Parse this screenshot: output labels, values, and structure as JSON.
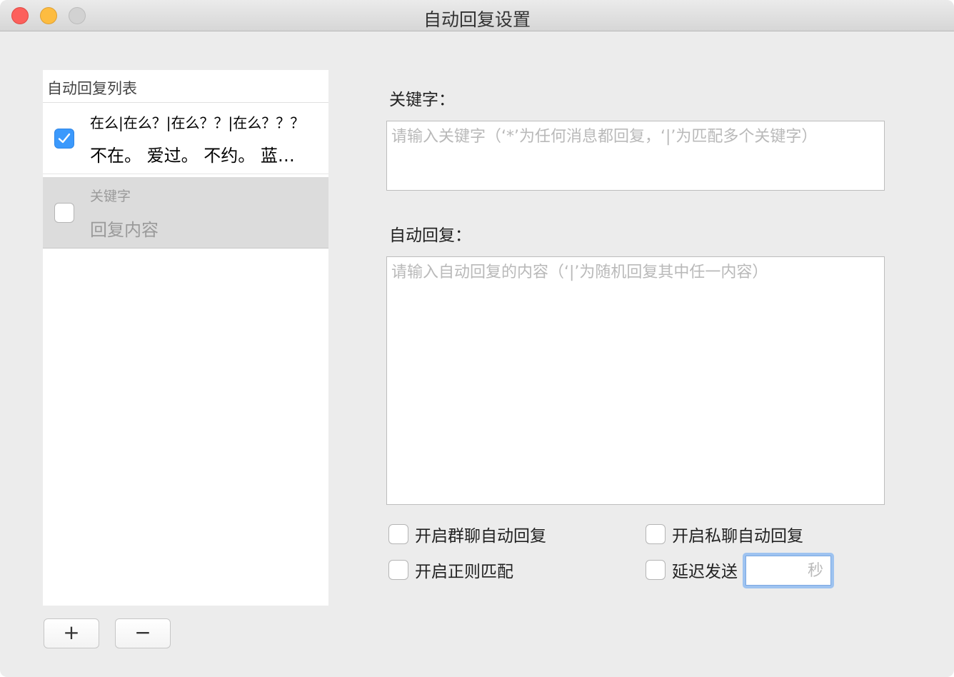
{
  "window": {
    "title": "自动回复设置"
  },
  "list": {
    "header": "自动回复列表",
    "items": [
      {
        "checked": true,
        "keyword": "在么|在么？|在么？？|在么？？？",
        "reply": "不在。 爱过。 不约。 蓝瘦香菇"
      },
      {
        "checked": false,
        "keyword": "关键字",
        "reply": "回复内容"
      }
    ],
    "add_label": "+",
    "remove_label": "−"
  },
  "form": {
    "keyword_label": "关键字：",
    "keyword_placeholder": "请输入关键字（‘*’为任何消息都回复，‘|’为匹配多个关键字）",
    "reply_label": "自动回复：",
    "reply_placeholder": "请输入自动回复的内容（‘|’为随机回复其中任一内容）",
    "options": {
      "group_label": "开启群聊自动回复",
      "private_label": "开启私聊自动回复",
      "regex_label": "开启正则匹配",
      "delay_label": "延迟发送"
    },
    "delay_placeholder": "秒"
  },
  "colors": {
    "accent": "#3b99fc",
    "window_bg": "#ececec",
    "selected_row": "#dcdcdc",
    "focus_ring": "#9ec3f0"
  }
}
